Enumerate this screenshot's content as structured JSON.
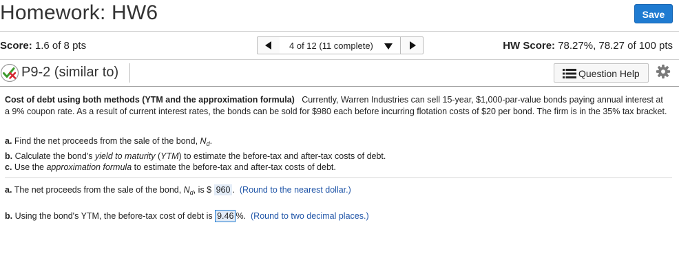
{
  "header": {
    "title": "Homework: HW6",
    "save_label": "Save"
  },
  "score_row": {
    "score_label": "Score:",
    "score_value": "1.6 of 8 pts",
    "nav_position": "4 of 12 (11 complete)",
    "hw_score_label": "HW Score:",
    "hw_score_value": "78.27%, 78.27 of 100 pts"
  },
  "question": {
    "title": "P9-2 (similar to)",
    "help_label": "Question Help",
    "status_icon": "partially-correct-icon"
  },
  "problem": {
    "heading": "Cost of debt using both methods (YTM and the approximation formula)",
    "body": "Currently, Warren Industries can sell 15-year, $1,000-par-value bonds paying annual interest at a 9% coupon rate.  As a result of current interest rates, the bonds can be sold for $980 each before incurring flotation costs of $20 per bond.  The firm is in the 35% tax bracket."
  },
  "parts": [
    {
      "letter": "a.",
      "pre": "Find the net proceeds from the sale of the bond, ",
      "var": "N",
      "sub": "d",
      "post": "."
    },
    {
      "letter": "b.",
      "pre": "Calculate the bond's ",
      "em": "yield to maturity",
      "mid": " (",
      "em2": "YTM",
      "post": ") to estimate the before-tax and after-tax costs of debt."
    },
    {
      "letter": "c.",
      "pre": "Use the ",
      "em": "approximation formula",
      "post": " to estimate the before-tax and after-tax costs of debt."
    }
  ],
  "answers": {
    "a": {
      "letter": "a.",
      "pre": "The net proceeds from the sale of the bond, ",
      "var": "N",
      "sub": "d",
      "mid": ", is $ ",
      "value": "960",
      "post": ".",
      "hint": "(Round to the nearest dollar.)"
    },
    "b": {
      "letter": "b.",
      "pre": "Using the bond's YTM, the before-tax cost of debt is ",
      "value": "9.46",
      "post": "%.",
      "hint": "(Round to two decimal places.)"
    }
  },
  "colors": {
    "save_button": "#1f7bd1",
    "hint_text": "#2156a8",
    "answer_fill": "#e3ecf7"
  }
}
